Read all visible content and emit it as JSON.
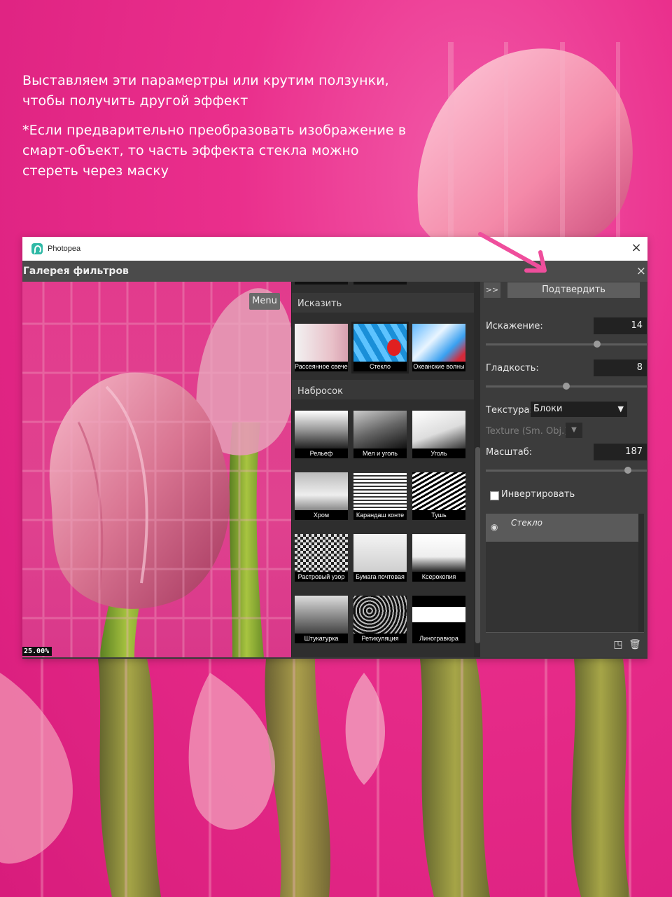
{
  "captions": {
    "line1": "Выставляем эти парамертры или крутим ползунки, чтобы получить другой эффект",
    "line2": "*Если предварительно преобразовать изображение в смарт-объект, то часть эффекта стекла можно стереть через маску"
  },
  "window": {
    "app_name": "Photopea",
    "close_icon": "×"
  },
  "dialog": {
    "title": "Галерея фильтров",
    "close_icon": "×"
  },
  "preview": {
    "menu_label": "Menu",
    "zoom": "25.00%"
  },
  "filters": {
    "categories": [
      {
        "name": "Исказить",
        "items": [
          "Рассеянное свечение",
          "Стекло",
          "Океанские волны"
        ]
      },
      {
        "name": "Набросок",
        "items": [
          "Рельеф",
          "Мел и уголь",
          "Уголь",
          "Хром",
          "Карандаш конте",
          "Тушь",
          "Растровый узор",
          "Бумага почтовая",
          "Ксерокопия",
          "Штукатурка",
          "Ретикуляция",
          "Линогравюра"
        ]
      }
    ],
    "selected": "Стекло"
  },
  "settings": {
    "expand_label": ">>",
    "confirm_label": "Подтвердить",
    "distortion": {
      "label": "Искажение:",
      "value": "14",
      "fraction": 0.7
    },
    "smoothness": {
      "label": "Гладкость:",
      "value": "8",
      "fraction": 0.5
    },
    "texture": {
      "label": "Текстура:",
      "value": "Блоки"
    },
    "texture_smart": {
      "label": "Texture (Sm. Obj.):"
    },
    "scale": {
      "label": "Масштаб:",
      "value": "187",
      "fraction": 0.9
    },
    "invert": {
      "label": "Инвертировать",
      "checked": false
    },
    "layers": [
      {
        "name": "Стекло",
        "visible": true
      }
    ]
  },
  "colors": {
    "background": "#e0388c",
    "accent_arrow": "#f25aa8",
    "dialog_bg": "#3a3a3a"
  }
}
